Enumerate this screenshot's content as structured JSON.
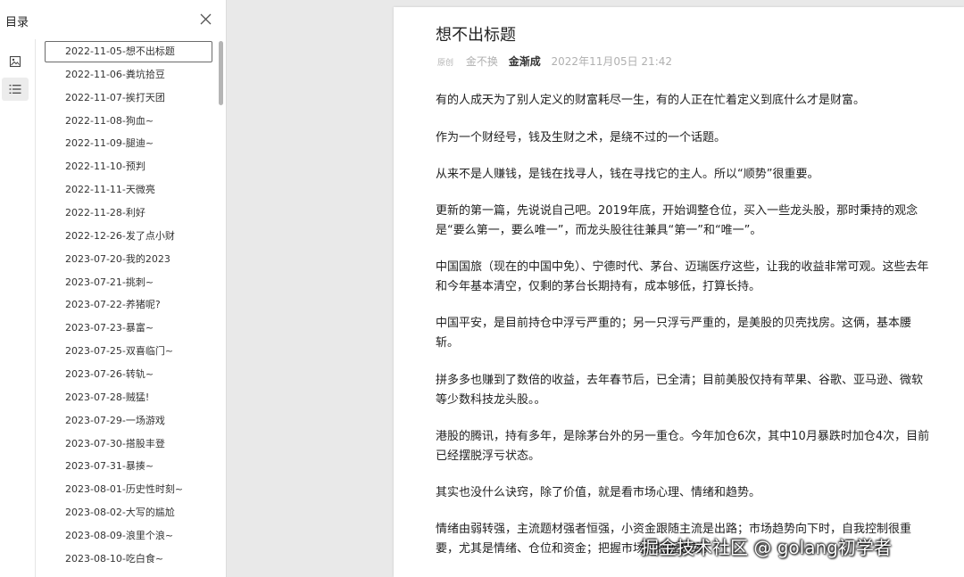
{
  "sidebar": {
    "title": "目录",
    "toc": [
      "2022-11-05-想不出标题",
      "2022-11-06-粪坑拾豆",
      "2022-11-07-挨打天团",
      "2022-11-08-狗血~",
      "2022-11-09-腿迪~",
      "2022-11-10-预判",
      "2022-11-11-天微亮",
      "2022-11-28-利好",
      "2022-12-26-发了点小财",
      "2023-07-20-我的2023",
      "2023-07-21-挑刺~",
      "2023-07-22-养猪呢?",
      "2023-07-23-暴富~",
      "2023-07-25-双喜临门~",
      "2023-07-26-转轨~",
      "2023-07-28-贼猛!",
      "2023-07-29-一场游戏",
      "2023-07-30-搭股丰登",
      "2023-07-31-暴揍~",
      "2023-08-01-历史性时刻~",
      "2023-08-02-大写的尴尬",
      "2023-08-09-浪里个浪~",
      "2023-08-10-吃白食~"
    ]
  },
  "article": {
    "title": "想不出标题",
    "tag": "原创",
    "meta_1": "金不换",
    "author": "金渐成",
    "datetime": "2022年11月05日 21:42",
    "paragraphs": [
      "有的人成天为了别人定义的财富耗尽一生，有的人正在忙着定义到底什么才是财富。",
      "作为一个财经号，钱及生财之术，是绕不过的一个话题。",
      "从来不是人赚钱，是钱在找寻人，钱在寻找它的主人。所以“顺势”很重要。",
      "更新的第一篇，先说说自己吧。2019年底，开始调整仓位，买入一些龙头股，那时秉持的观念是“要么第一，要么唯一”，而龙头股往往兼具“第一”和“唯一”。",
      "中国国旅（现在的中国中免）、宁德时代、茅台、迈瑞医疗这些，让我的收益非常可观。这些去年和今年基本清空，仅剩的茅台长期持有，成本够低，打算长持。",
      "中国平安，是目前持仓中浮亏严重的；另一只浮亏严重的，是美股的贝壳找房。这俩，基本腰斩。",
      "拼多多也赚到了数倍的收益，去年春节后，已全清；目前美股仅持有苹果、谷歌、亚马逊、微软等少数科技龙头股。。",
      "港股的腾讯，持有多年，是除茅台外的另一重仓。今年加仓6次，其中10月暴跌时加仓4次，目前已经摆脱浮亏状态。",
      "其实也没什么诀窍，除了价值，就是看市场心理、情绪和趋势。",
      "情绪由弱转强，主流题材强者恒强，小资金跟随主流是出路；市场趋势向下时，自我控制很重要，尤其是情绪、仓位和资金；把握市场，把握趋势。"
    ]
  },
  "watermark": "掘金技术社区 @ golang初学者"
}
